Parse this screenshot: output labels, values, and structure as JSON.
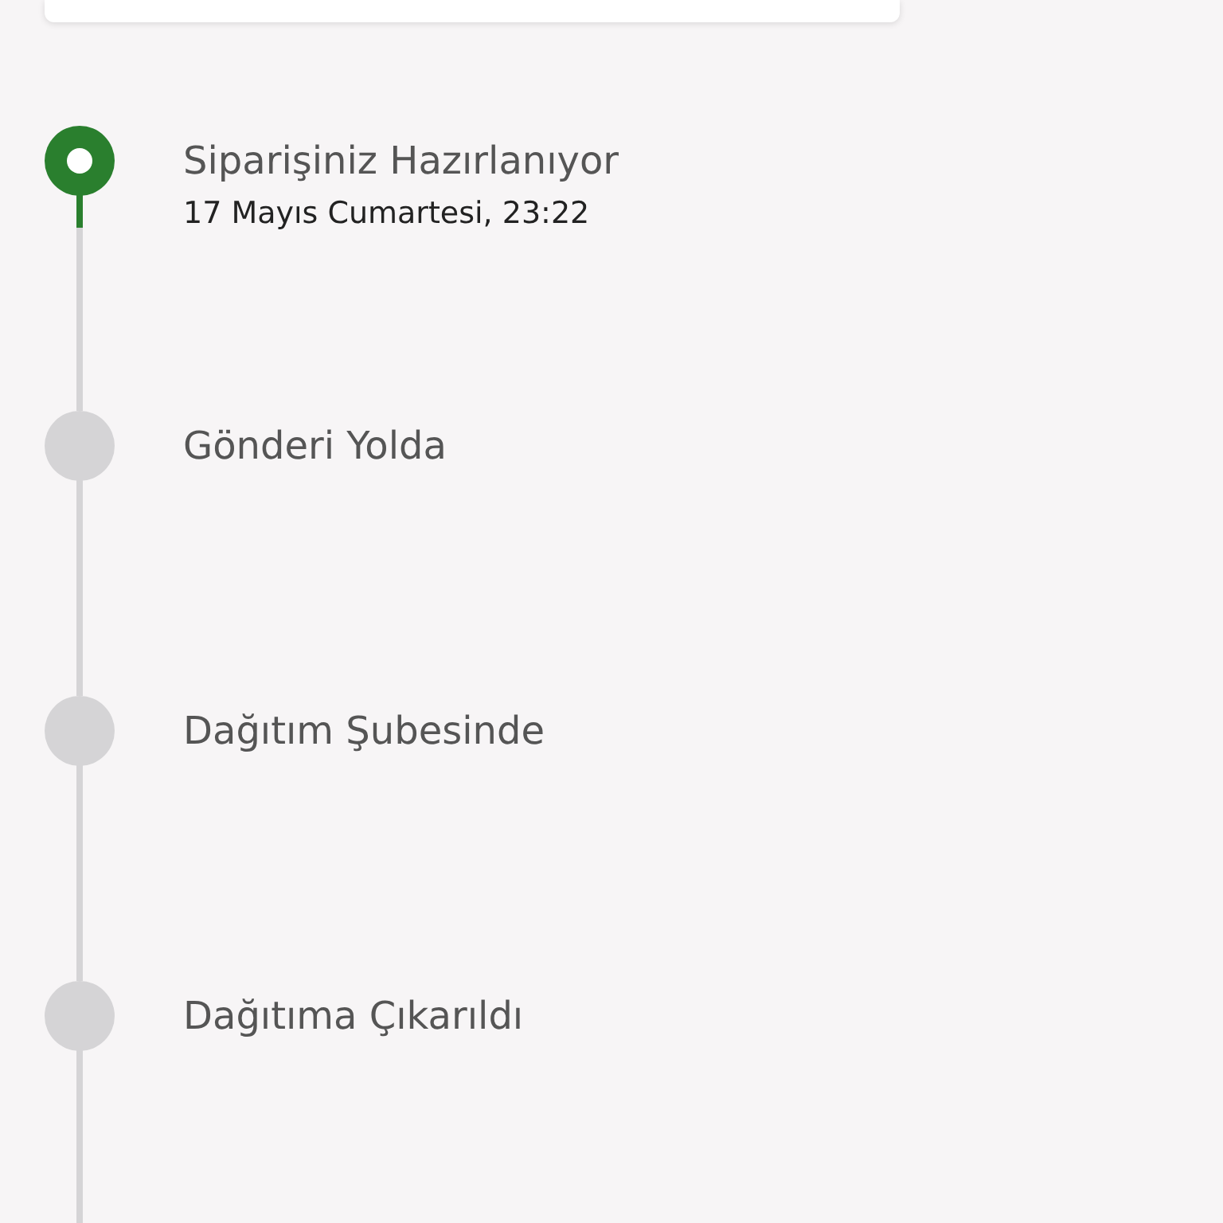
{
  "steps": [
    {
      "title": "Siparişiniz Hazırlanıyor",
      "date": "17 Mayıs Cumartesi, 23:22",
      "done": true
    },
    {
      "title": "Gönderi Yolda",
      "done": false
    },
    {
      "title": "Dağıtım Şubesinde",
      "done": false
    },
    {
      "title": "Dağıtıma Çıkarıldı",
      "done": false
    }
  ]
}
